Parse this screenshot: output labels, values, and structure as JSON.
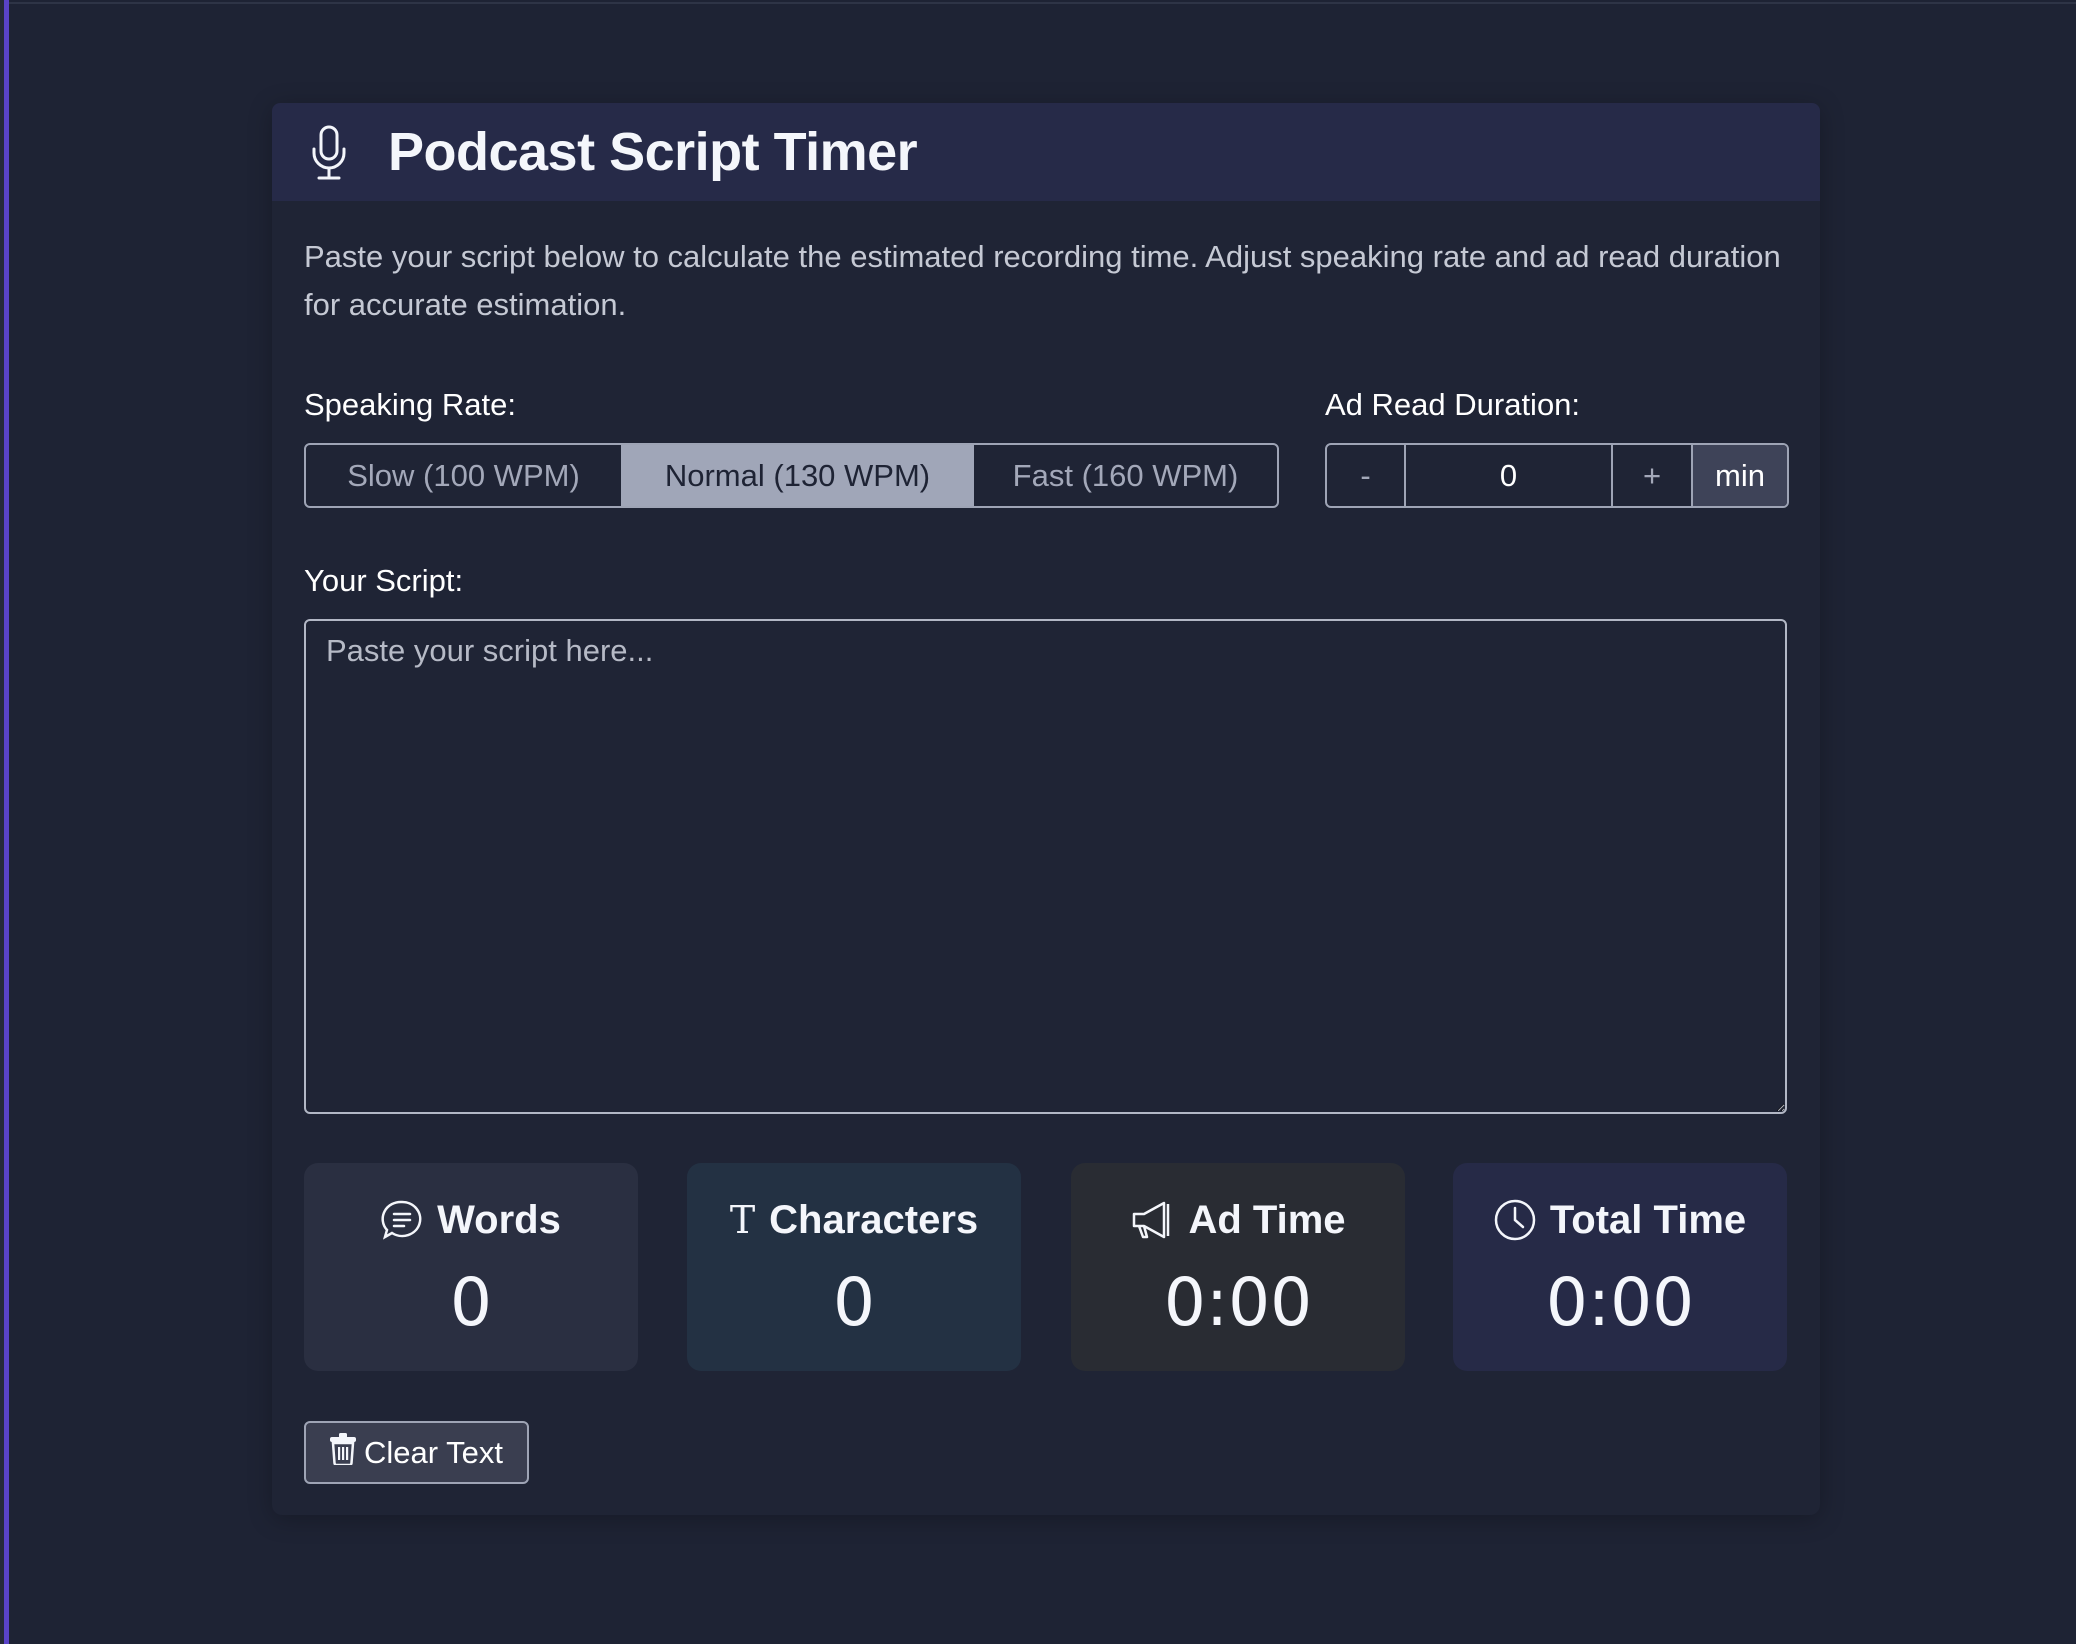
{
  "app": {
    "title": "Podcast Script Timer",
    "icon": "microphone-icon",
    "description": "Paste your script below to calculate the estimated recording time. Adjust speaking rate and ad read duration for accurate estimation."
  },
  "speaking_rate": {
    "label": "Speaking Rate:",
    "options": [
      {
        "label": "Slow (100 WPM)",
        "wpm": 100,
        "active": false
      },
      {
        "label": "Normal (130 WPM)",
        "wpm": 130,
        "active": true
      },
      {
        "label": "Fast (160 WPM)",
        "wpm": 160,
        "active": false
      }
    ]
  },
  "ad_read": {
    "label": "Ad Read Duration:",
    "decrement_label": "-",
    "value": "0",
    "increment_label": "+",
    "unit": "min"
  },
  "script": {
    "label": "Your Script:",
    "placeholder": "Paste your script here...",
    "value": ""
  },
  "stats": [
    {
      "key": "words",
      "label": "Words",
      "value": "0",
      "icon": "speech-bubble-icon"
    },
    {
      "key": "characters",
      "label": "Characters",
      "value": "0",
      "icon": "text-type-icon"
    },
    {
      "key": "ad_time",
      "label": "Ad Time",
      "value": "0:00",
      "icon": "megaphone-icon"
    },
    {
      "key": "total_time",
      "label": "Total Time",
      "value": "0:00",
      "icon": "clock-icon"
    }
  ],
  "actions": {
    "clear_label": "Clear Text",
    "clear_icon": "trash-icon"
  },
  "colors": {
    "accent": "#5a43c8",
    "background": "#1e2334",
    "header_bg": "#262a48",
    "active_rate_bg": "#a0a6b8"
  }
}
